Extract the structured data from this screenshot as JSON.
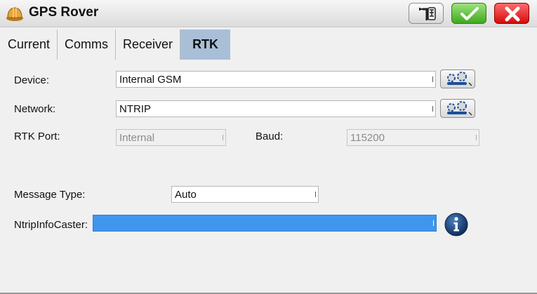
{
  "window": {
    "title": "GPS Rover"
  },
  "toolbar": {
    "tools_icon": "pole-tools-icon",
    "ok_icon": "checkmark-icon",
    "close_icon": "close-icon"
  },
  "tabs": [
    {
      "label": "Current",
      "active": false
    },
    {
      "label": "Comms",
      "active": false
    },
    {
      "label": "Receiver",
      "active": false
    },
    {
      "label": "RTK",
      "active": true
    }
  ],
  "form": {
    "device": {
      "label": "Device:",
      "value": "Internal GSM"
    },
    "network": {
      "label": "Network:",
      "value": "NTRIP"
    },
    "rtk_port": {
      "label": "RTK Port:",
      "value": "Internal"
    },
    "baud": {
      "label": "Baud:",
      "value": "115200"
    },
    "message_type": {
      "label": "Message Type:",
      "value": "Auto"
    },
    "ntrip_caster": {
      "label": "NtripInfoCaster:",
      "value": ""
    }
  },
  "colors": {
    "active_tab": "#a9bfd8",
    "selected_field": "#3f96ec",
    "ok_green": "#3fa91d",
    "close_red": "#d40c0c",
    "info_blue": "#173a6e"
  }
}
